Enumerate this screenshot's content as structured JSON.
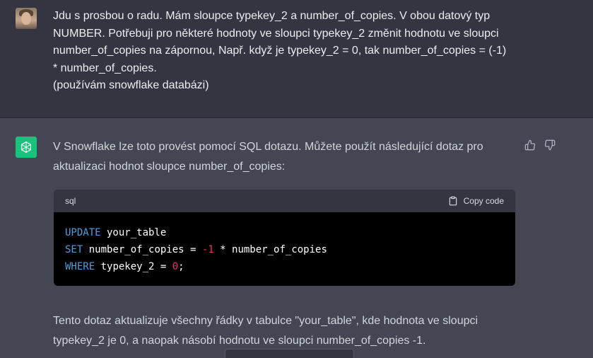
{
  "user_message": {
    "lines": [
      "Jdu s prosbou o radu. Mám sloupce typekey_2 a number_of_copies. V obou datový typ",
      "NUMBER. Potřebuji pro některé hodnoty ve sloupci typekey_2 změnit hodnotu ve sloupci",
      "number_of_copies na zápornou, Např. když je typekey_2 = 0, tak number_of_copies = (-1)",
      "* number_of_copies.",
      "(používám snowflake databázi)"
    ]
  },
  "assistant_message": {
    "intro_lines": [
      "V Snowflake lze toto provést pomocí SQL dotazu. Můžete použít následující dotaz pro",
      "aktualizaci hodnot sloupce number_of_copies:"
    ],
    "code_block": {
      "language": "sql",
      "copy_label": "Copy code",
      "line1": {
        "kw": "UPDATE",
        "rest": " your_table"
      },
      "line2": {
        "kw": "SET",
        "rest1": " number_of_copies = ",
        "num": "-1",
        "rest2": " * number_of_copies"
      },
      "line3": {
        "kw": "WHERE",
        "rest1": " typekey_2 = ",
        "num": "0",
        "rest2": ";"
      }
    },
    "tail_lines": [
      "Tento dotaz aktualizuje všechny řádky v tabulce \"your_table\", kde hodnota ve sloupci",
      "typekey_2 je 0, a naopak násobí hodnotu ve sloupci number_of_copies -1."
    ],
    "feedback": {
      "thumbs_up": "thumbs-up-icon",
      "thumbs_down": "thumbs-down-icon"
    }
  },
  "colors": {
    "user_bg": "#343541",
    "assistant_bg": "#444654",
    "gpt_avatar": "#19c37d",
    "sql_keyword": "#4c9fe0",
    "sql_number": "#e6336b"
  }
}
